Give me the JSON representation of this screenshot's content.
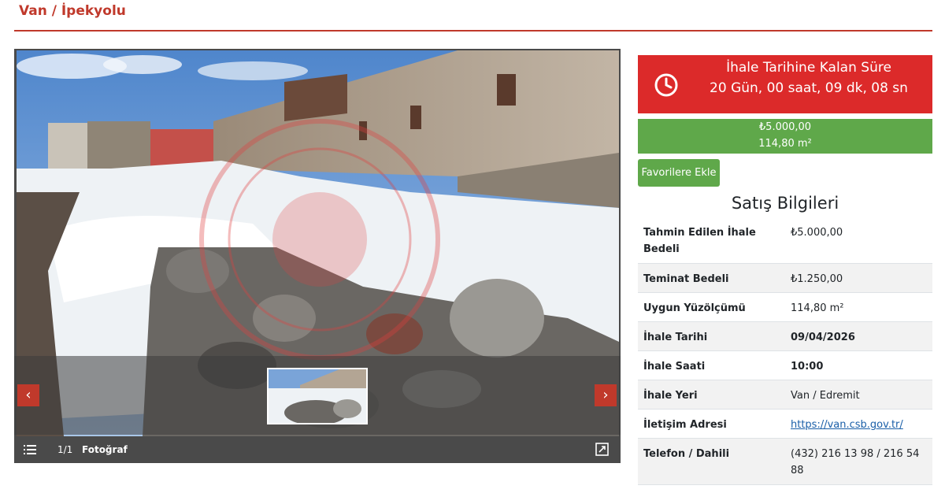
{
  "breadcrumb": "Van / İpekyolu",
  "gallery": {
    "counter": "1/1",
    "label": "Fotoğraf",
    "icons": {
      "menu": "list-icon",
      "expand": "expand-icon",
      "prev": "chevron-left-icon",
      "next": "chevron-right-icon"
    }
  },
  "countdown": {
    "title": "İhale Tarihine Kalan Süre",
    "value": "20 Gün, 00 saat, 09 dk, 08 sn",
    "icon": "clock-icon",
    "color": "#dc2a2a"
  },
  "price": {
    "amount": "₺5.000,00",
    "area": "114,80 m²",
    "color": "#5fa84a"
  },
  "favorites_button": "Favorilere Ekle",
  "sale_info": {
    "title": "Satış Bilgileri",
    "rows": [
      {
        "label": "Tahmin Edilen İhale Bedeli",
        "value": "₺5.000,00"
      },
      {
        "label": "Teminat Bedeli",
        "value": "₺1.250,00"
      },
      {
        "label": "Uygun Yüzölçümü",
        "value": "114,80 m²"
      },
      {
        "label": "İhale Tarihi",
        "value": "09/04/2026"
      },
      {
        "label": "İhale Saati",
        "value": "10:00"
      },
      {
        "label": "İhale Yeri",
        "value": "Van / Edremit"
      },
      {
        "label": "İletişim Adresi",
        "value": "https://van.csb.gov.tr/"
      },
      {
        "label": "Telefon / Dahili",
        "value": "(432) 216 13 98 / 216 54 88"
      }
    ]
  },
  "accent_color": "#c0392b"
}
